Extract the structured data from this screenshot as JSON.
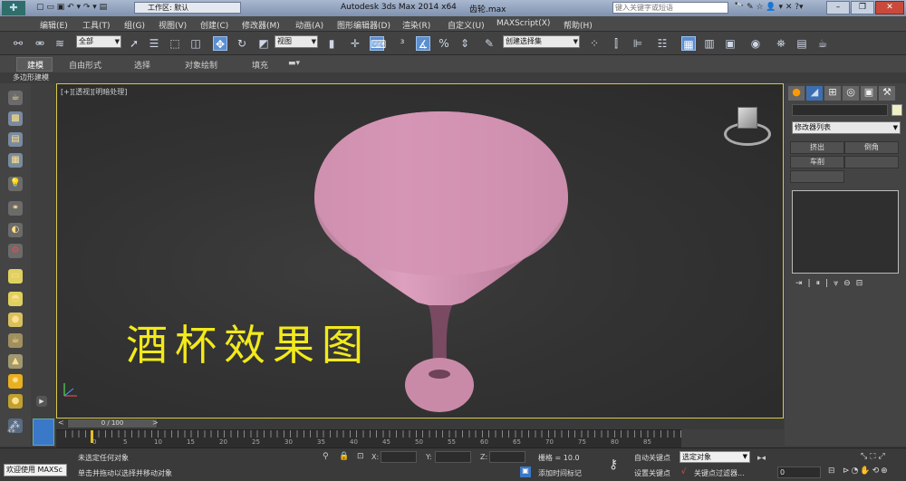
{
  "titlebar": {
    "workspace_label": "工作区: 默认",
    "app_title": "Autodesk 3ds Max  2014 x64",
    "file_name": "齿轮.max",
    "search_placeholder": "键入关键字或短语"
  },
  "menu": [
    "编辑(E)",
    "工具(T)",
    "组(G)",
    "视图(V)",
    "创建(C)",
    "修改器(M)",
    "动画(A)",
    "图形编辑器(D)",
    "渲染(R)",
    "自定义(U)",
    "MAXScript(X)",
    "帮助(H)"
  ],
  "toolbar": {
    "selection_filter": "全部",
    "ref_coord": "视图",
    "named_selection": "创建选择集"
  },
  "ribbon": {
    "tabs": [
      "建模",
      "自由形式",
      "选择",
      "对象绘制",
      "填充"
    ],
    "sub_label": "多边形建模"
  },
  "viewport": {
    "label": "[+][透视][明暗处理]",
    "overlay_text": "酒杯效果图",
    "overlay_color": "#f2ea1a",
    "object_color": "#c98aa8"
  },
  "command_panel": {
    "modifier_list": "修改器列表",
    "buttons": [
      "挤出",
      "倒角",
      "车削",
      ""
    ]
  },
  "timeline": {
    "frame_counter": "0 / 100",
    "ticks": [
      "0",
      "5",
      "10",
      "15",
      "20",
      "25",
      "30",
      "35",
      "40",
      "45",
      "50",
      "55",
      "60",
      "65",
      "70",
      "75",
      "80",
      "85"
    ]
  },
  "status": {
    "listener": "欢迎使用 MAXSc",
    "selection_info": "未选定任何对象",
    "prompt": "单击并拖动以选择并移动对象",
    "x_label": "X:",
    "y_label": "Y:",
    "z_label": "Z:",
    "grid": "栅格 = 10.0",
    "add_time_tag": "添加时间标记",
    "auto_key": "自动关键点",
    "selected_option": "选定对象",
    "set_key": "设置关键点",
    "key_filters": "关键点过滤器...",
    "current_frame": "0"
  }
}
